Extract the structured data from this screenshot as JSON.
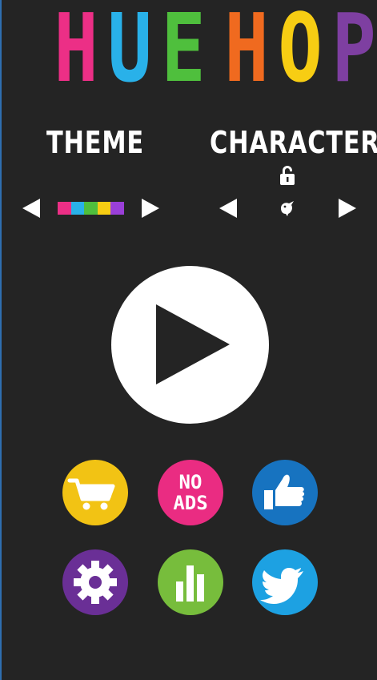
{
  "logo": {
    "letters": [
      {
        "ch": "H",
        "color": "#ec2f86"
      },
      {
        "ch": "U",
        "color": "#29b1e9"
      },
      {
        "ch": "E",
        "color": "#4fbf3d"
      },
      {
        "ch": " ",
        "color": "#242424"
      },
      {
        "ch": "H",
        "color": "#f06a1f"
      },
      {
        "ch": "O",
        "color": "#f7cd13"
      },
      {
        "ch": "P",
        "color": "#7e3fa1"
      }
    ]
  },
  "theme": {
    "label": "THEME",
    "swatches": [
      "#ec2f86",
      "#29b1e9",
      "#4fbf3d",
      "#f7cd13",
      "#9a3fd8"
    ]
  },
  "character": {
    "label": "CHARACTER",
    "lock_icon": "lock-icon",
    "current_icon": "bird-icon"
  },
  "buttons": {
    "play": "play-icon",
    "shop": {
      "icon": "cart-icon",
      "color": "#f2c314"
    },
    "no_ads": {
      "line1": "NO",
      "line2": "ADS",
      "color": "#ea2c82"
    },
    "like": {
      "icon": "thumbs-up-icon",
      "color": "#1773c0"
    },
    "settings": {
      "icon": "gear-icon",
      "color": "#6a2f96"
    },
    "leaderboard": {
      "icon": "bar-chart-icon",
      "color": "#77bd3c"
    },
    "twitter": {
      "icon": "twitter-bird-icon",
      "color": "#1da1e2"
    }
  }
}
